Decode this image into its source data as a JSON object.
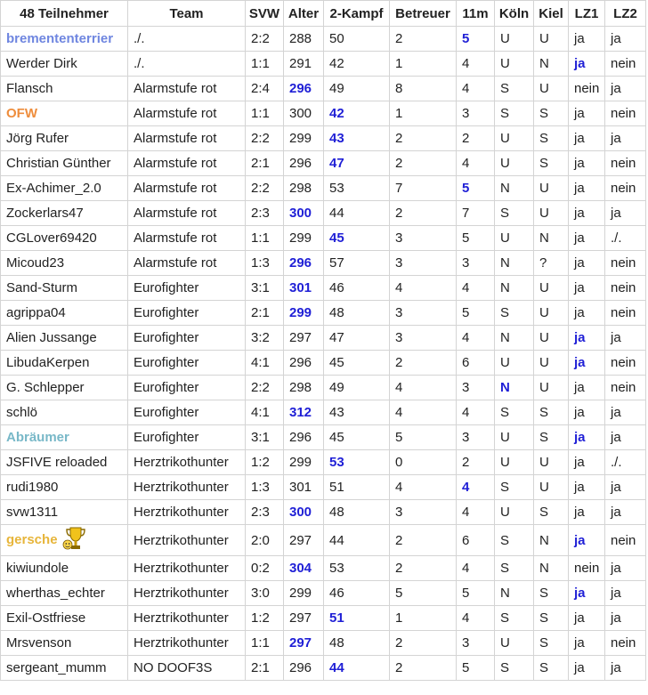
{
  "columns": [
    "48 Teilnehmer",
    "Team",
    "SVW",
    "Alter",
    "2-Kampf",
    "Betreuer",
    "11m",
    "Köln",
    "Kiel",
    "LZ1",
    "LZ2"
  ],
  "rows": [
    {
      "name": "bremententerrier",
      "name_style": "blue",
      "cells": [
        "./.",
        "2:2",
        "288",
        "50",
        "2",
        "5",
        "U",
        "U",
        "ja",
        "ja"
      ],
      "bold": [
        5
      ]
    },
    {
      "name": "Werder Dirk",
      "cells": [
        "./.",
        "1:1",
        "291",
        "42",
        "1",
        "4",
        "U",
        "N",
        "ja",
        "nein"
      ],
      "bold": [
        8
      ]
    },
    {
      "name": "Flansch",
      "cells": [
        "Alarmstufe rot",
        "2:4",
        "296",
        "49",
        "8",
        "4",
        "S",
        "U",
        "nein",
        "ja"
      ],
      "bold": [
        2
      ]
    },
    {
      "name": "OFW",
      "name_style": "orange",
      "cells": [
        "Alarmstufe rot",
        "1:1",
        "300",
        "42",
        "1",
        "3",
        "S",
        "S",
        "ja",
        "nein"
      ],
      "bold": [
        3
      ]
    },
    {
      "name": "Jörg Rufer",
      "cells": [
        "Alarmstufe rot",
        "2:2",
        "299",
        "43",
        "2",
        "2",
        "U",
        "S",
        "ja",
        "ja"
      ],
      "bold": [
        3
      ]
    },
    {
      "name": "Christian Günther",
      "cells": [
        "Alarmstufe rot",
        "2:1",
        "296",
        "47",
        "2",
        "4",
        "U",
        "S",
        "ja",
        "nein"
      ],
      "bold": [
        3
      ]
    },
    {
      "name": "Ex-Achimer_2.0",
      "cells": [
        "Alarmstufe rot",
        "2:2",
        "298",
        "53",
        "7",
        "5",
        "N",
        "U",
        "ja",
        "nein"
      ],
      "bold": [
        5
      ]
    },
    {
      "name": "Zockerlars47",
      "cells": [
        "Alarmstufe rot",
        "2:3",
        "300",
        "44",
        "2",
        "7",
        "S",
        "U",
        "ja",
        "ja"
      ],
      "bold": [
        2
      ]
    },
    {
      "name": "CGLover69420",
      "cells": [
        "Alarmstufe rot",
        "1:1",
        "299",
        "45",
        "3",
        "5",
        "U",
        "N",
        "ja",
        "./."
      ],
      "bold": [
        3
      ]
    },
    {
      "name": "Micoud23",
      "cells": [
        "Alarmstufe rot",
        "1:3",
        "296",
        "57",
        "3",
        "3",
        "N",
        "?",
        "ja",
        "nein"
      ],
      "bold": [
        2
      ]
    },
    {
      "name": "Sand-Sturm",
      "cells": [
        "Eurofighter",
        "3:1",
        "301",
        "46",
        "4",
        "4",
        "N",
        "U",
        "ja",
        "nein"
      ],
      "bold": [
        2
      ]
    },
    {
      "name": "agrippa04",
      "cells": [
        "Eurofighter",
        "2:1",
        "299",
        "48",
        "3",
        "5",
        "S",
        "U",
        "ja",
        "nein"
      ],
      "bold": [
        2
      ]
    },
    {
      "name": "Alien Jussange",
      "cells": [
        "Eurofighter",
        "3:2",
        "297",
        "47",
        "3",
        "4",
        "N",
        "U",
        "ja",
        "ja"
      ],
      "bold": [
        8
      ]
    },
    {
      "name": "LibudaKerpen",
      "cells": [
        "Eurofighter",
        "4:1",
        "296",
        "45",
        "2",
        "6",
        "U",
        "U",
        "ja",
        "nein"
      ],
      "bold": [
        8
      ]
    },
    {
      "name": "G. Schlepper",
      "cells": [
        "Eurofighter",
        "2:2",
        "298",
        "49",
        "4",
        "3",
        "N",
        "U",
        "ja",
        "nein"
      ],
      "bold": [
        6
      ]
    },
    {
      "name": "schlö",
      "cells": [
        "Eurofighter",
        "4:1",
        "312",
        "43",
        "4",
        "4",
        "S",
        "S",
        "ja",
        "ja"
      ],
      "bold": [
        2
      ]
    },
    {
      "name": "Abräumer",
      "name_style": "teal",
      "cells": [
        "Eurofighter",
        "3:1",
        "296",
        "45",
        "5",
        "3",
        "U",
        "S",
        "ja",
        "ja"
      ],
      "bold": [
        8
      ]
    },
    {
      "name": "JSFIVE reloaded",
      "cells": [
        "Herztrikothunter",
        "1:2",
        "299",
        "53",
        "0",
        "2",
        "U",
        "U",
        "ja",
        "./."
      ],
      "bold": [
        3
      ]
    },
    {
      "name": "rudi1980",
      "cells": [
        "Herztrikothunter",
        "1:3",
        "301",
        "51",
        "4",
        "4",
        "S",
        "U",
        "ja",
        "ja"
      ],
      "bold": [
        5
      ]
    },
    {
      "name": "svw1311",
      "cells": [
        "Herztrikothunter",
        "2:3",
        "300",
        "48",
        "3",
        "4",
        "U",
        "S",
        "ja",
        "ja"
      ],
      "bold": [
        2
      ]
    },
    {
      "name": "gersche",
      "name_style": "gold",
      "trophy": "trophy-icon",
      "cells": [
        "Herztrikothunter",
        "2:0",
        "297",
        "44",
        "2",
        "6",
        "S",
        "N",
        "ja",
        "nein"
      ],
      "bold": [
        8
      ]
    },
    {
      "name": "kiwiundole",
      "cells": [
        "Herztrikothunter",
        "0:2",
        "304",
        "53",
        "2",
        "4",
        "S",
        "N",
        "nein",
        "ja"
      ],
      "bold": [
        2
      ]
    },
    {
      "name": "wherthas_echter",
      "cells": [
        "Herztrikothunter",
        "3:0",
        "299",
        "46",
        "5",
        "5",
        "N",
        "S",
        "ja",
        "ja"
      ],
      "bold": [
        8
      ]
    },
    {
      "name": "Exil-Ostfriese",
      "cells": [
        "Herztrikothunter",
        "1:2",
        "297",
        "51",
        "1",
        "4",
        "S",
        "S",
        "ja",
        "ja"
      ],
      "bold": [
        3
      ]
    },
    {
      "name": "Mrsvenson",
      "cells": [
        "Herztrikothunter",
        "1:1",
        "297",
        "48",
        "2",
        "3",
        "U",
        "S",
        "ja",
        "nein"
      ],
      "bold": [
        2
      ]
    },
    {
      "name": "sergeant_mumm",
      "cells": [
        "NO DOOF3S",
        "2:1",
        "296",
        "44",
        "2",
        "5",
        "S",
        "S",
        "ja",
        "ja"
      ],
      "bold": [
        3
      ]
    }
  ],
  "colors": {
    "bold_value": "#1f1fd6",
    "name_blue": "#6f86e0",
    "name_orange": "#ee8d3c",
    "name_teal": "#78b8c8",
    "name_gold": "#e7b53a"
  }
}
